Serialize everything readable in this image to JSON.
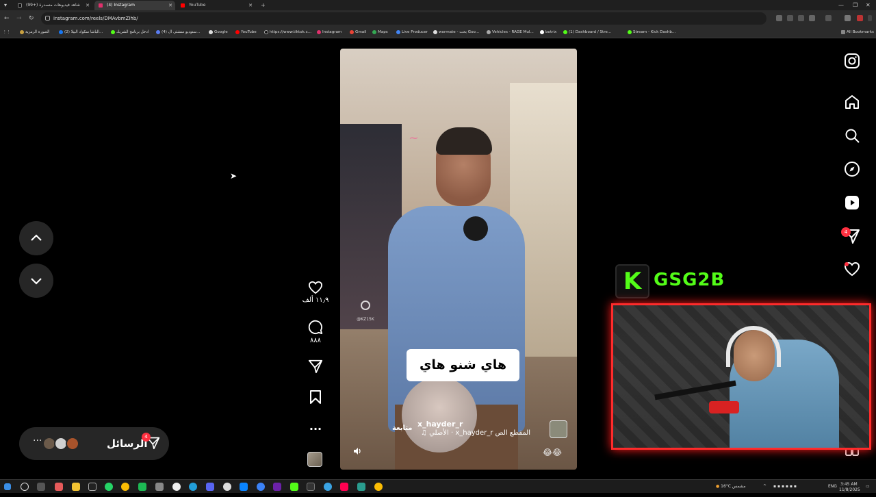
{
  "browser": {
    "tabs": [
      {
        "title": "(99+) شاهد فيديوهات متصدرة",
        "active": false
      },
      {
        "title": "(4) Instagram",
        "active": true
      },
      {
        "title": "YouTube",
        "active": false
      }
    ],
    "url": "instagram.com/reels/DMAvbmZIhb/",
    "bookmarks": [
      "الصورة الرمزية",
      "(2) الباشا سكواد البيلا...",
      "ادخل برنامج الشريك",
      "(4) ستوديو منشئي ال...",
      "Google",
      "YouTube",
      "https://www.tiktok.c...",
      "Instagram",
      "Gmail",
      "Maps",
      "Live Producer",
      "wormate - بحث Goo...",
      "Vehicles - RAGE Mul...",
      "botrix",
      "(1) Dashboard / Stre...",
      "Stream - Kick Dashb..."
    ],
    "all_bookmarks": "All Bookmarks"
  },
  "reel": {
    "subtitle": "هاي شنو هاي",
    "author": "x_hayder_r",
    "follow": "متابعة",
    "audio": "الأصلي · x_hayder_r  المقطع الص",
    "emojis": "😂😂",
    "watermark": "@KZ15K",
    "likes": "١١٫٩ ألف",
    "comments": "٨٨٨"
  },
  "messages": {
    "label": "الرسائل",
    "badge": "4"
  },
  "rail": {
    "notifications_badge": "4"
  },
  "stream": {
    "name": "GSG2B",
    "logo_letter": "K"
  },
  "taskbar": {
    "weather": "16°C مشمس",
    "lang": "ENG",
    "time": "3:45 AM",
    "date": "11/8/2025"
  },
  "colors": {
    "kick_green": "#53fc18",
    "badge_red": "#ff3040",
    "webcam_border": "#ff2b2b"
  }
}
